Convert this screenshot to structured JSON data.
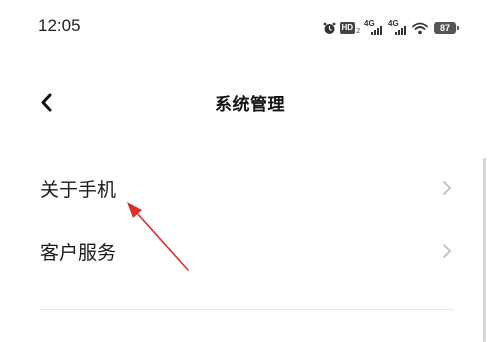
{
  "status_bar": {
    "time": "12:05",
    "hd_label": "HD",
    "hd_sub": "2",
    "network_1": "4G",
    "network_2": "4G",
    "battery": "87",
    "icons": [
      "alarm-icon",
      "hd-icon",
      "signal-icon",
      "signal-icon",
      "wifi-icon",
      "battery-icon"
    ]
  },
  "header": {
    "title": "系统管理",
    "back_icon": "back-arrow-icon"
  },
  "list": {
    "items": [
      {
        "label": "关于手机",
        "icon": "chevron-right-icon"
      },
      {
        "label": "客户服务",
        "icon": "chevron-right-icon"
      }
    ]
  },
  "colors": {
    "annotation": "#d9302c",
    "chevron": "#bfbfbf",
    "divider": "#e6e6e6",
    "scrollbar": "#d6d6d6"
  }
}
